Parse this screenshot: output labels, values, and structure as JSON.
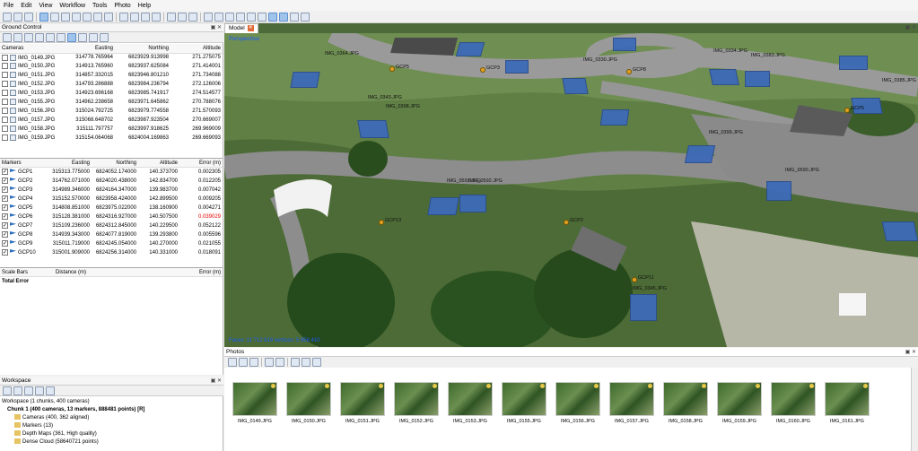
{
  "menu": [
    "File",
    "Edit",
    "View",
    "Workflow",
    "Tools",
    "Photo",
    "Help"
  ],
  "ground_control": {
    "title": "Ground Control",
    "cameras_headers": [
      "Cameras",
      "Easting",
      "Northing",
      "Altitude"
    ],
    "cameras": [
      [
        "IMG_0149.JPG",
        "314778.765964",
        "6823929.913998",
        "271.275075"
      ],
      [
        "IMG_0150.JPG",
        "314913.765960",
        "6823937.625084",
        "271.414001"
      ],
      [
        "IMG_0151.JPG",
        "314857.332015",
        "6823946.801210",
        "271.734088"
      ],
      [
        "IMG_0152.JPG",
        "314793.286888",
        "6823984.236794",
        "272.126006"
      ],
      [
        "IMG_0153.JPG",
        "314923.696168",
        "6823985.741917",
        "274.514577"
      ],
      [
        "IMG_0155.JPG",
        "314962.238658",
        "6823971.645862",
        "270.788076"
      ],
      [
        "IMG_0156.JPG",
        "315024.792725",
        "6823979.774558",
        "271.570093"
      ],
      [
        "IMG_0157.JPG",
        "315068.648702",
        "6823987.923504",
        "270.669007"
      ],
      [
        "IMG_0158.JPG",
        "315111.797757",
        "6823997.918625",
        "269.969009"
      ],
      [
        "IMG_0159.JPG",
        "315154.064068",
        "6824004.169863",
        "269.669093"
      ]
    ],
    "markers_headers": [
      "Markers",
      "Easting",
      "Northing",
      "Altitude",
      "Error (m)"
    ],
    "markers": [
      [
        "GCP1",
        "315313.775000",
        "6824052.174000",
        "140.373700",
        "0.002305"
      ],
      [
        "GCP2",
        "314762.071000",
        "6824020.438000",
        "142.834700",
        "0.012205"
      ],
      [
        "GCP3",
        "314989.346000",
        "6824164.347000",
        "139.983700",
        "0.007042"
      ],
      [
        "GCP4",
        "315152.570000",
        "6823958.424000",
        "142.899500",
        "0.009205"
      ],
      [
        "GCP5",
        "314808.851000",
        "6823975.022000",
        "138.160900",
        "0.004271"
      ],
      [
        "GCP6",
        "315128.381000",
        "6824316.927000",
        "140.507500",
        "0.039029"
      ],
      [
        "GCP7",
        "315109.236000",
        "6824312.845000",
        "140.229500",
        "0.052122"
      ],
      [
        "GCP8",
        "314939.343000",
        "6824077.819000",
        "139.293800",
        "0.005596"
      ],
      [
        "GCP9",
        "315011.719000",
        "6824245.054000",
        "140.270000",
        "0.021055"
      ],
      [
        "GCP10",
        "315001.909000",
        "6824256.314000",
        "140.331000",
        "0.018091"
      ]
    ],
    "scalebar_headers": [
      "Scale Bars",
      "Distance (m)",
      "Error (m)"
    ],
    "total_error": "Total Error"
  },
  "model": {
    "tab": "Model",
    "view_mode": "Perspective",
    "status": "Faces: 11 712 819 vertices: 5 856 410",
    "camera_labels": [
      "IMG_0364.JPG",
      "IMG_0330.JPG",
      "IMG_0334.JPG",
      "IMG_0385.JPG",
      "IMG_0383.JPG",
      "IMG_0343.JPG",
      "IMG_0398.JPG",
      "IMG_0590.JPG",
      "IMG_0399.JPG",
      "IMG_0593.JPG",
      "IMG_0592.JPG",
      "IMG_0345.JPG"
    ],
    "gcp_labels": [
      "GCP3",
      "GCP8",
      "GCP5",
      "GCP5",
      "GCP13",
      "GCP2",
      "GCP11"
    ]
  },
  "photos": {
    "title": "Photos",
    "items": [
      "IMG_0149.JPG",
      "IMG_0150.JPG",
      "IMG_0151.JPG",
      "IMG_0152.JPG",
      "IMG_0153.JPG",
      "IMG_0155.JPG",
      "IMG_0156.JPG",
      "IMG_0157.JPG",
      "IMG_0158.JPG",
      "IMG_0159.JPG",
      "IMG_0160.JPG",
      "IMG_0161.JPG"
    ]
  },
  "workspace": {
    "title": "Workspace",
    "root": "Workspace (1 chunks, 400 cameras)",
    "chunk": "Chunk 1 (400 cameras, 13 markers, 888481 points) [R]",
    "items": [
      "Cameras (400, 362 aligned)",
      "Markers (13)",
      "Depth Maps (361, High quality)",
      "Dense Cloud (58640721 points)"
    ]
  }
}
